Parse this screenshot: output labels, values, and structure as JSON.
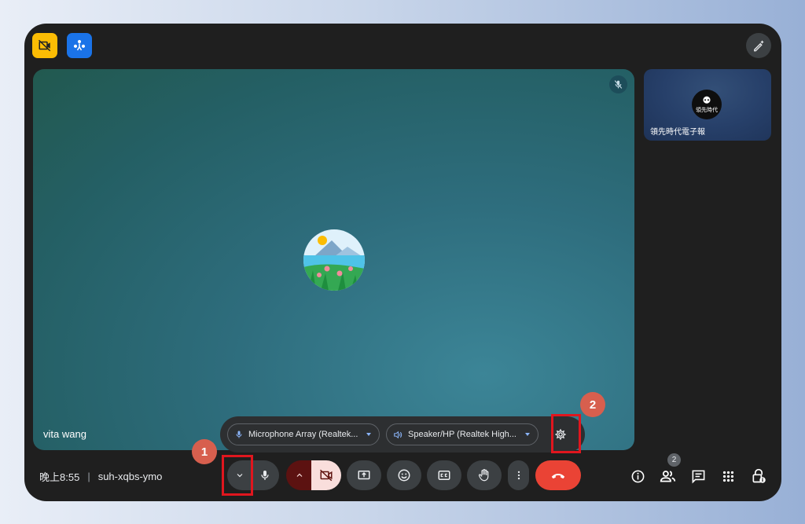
{
  "main_participant": {
    "name": "vita wang"
  },
  "side_participant": {
    "name": "領先時代電子報",
    "avatar_text": "領先時代"
  },
  "device_bar": {
    "microphone": "Microphone Array (Realtek...",
    "speaker": "Speaker/HP (Realtek High..."
  },
  "meeting": {
    "time": "晚上8:55",
    "code": "suh-xqbs-ymo",
    "separator": "|"
  },
  "participants_count": "2",
  "annotations": {
    "badge1": "1",
    "badge2": "2"
  },
  "colors": {
    "accent": "#1a73e8",
    "end_call": "#ea4335",
    "highlight": "#e0161e",
    "badge": "#d75f4e"
  },
  "icons": [
    "no-video-icon",
    "activity-icon",
    "magic-edit-icon",
    "mic-off-icon",
    "mic-icon",
    "speaker-icon",
    "dropdown-arrow-icon",
    "gear-icon",
    "chevron-down-icon",
    "chevron-up-icon",
    "camera-off-icon",
    "present-icon",
    "emoji-icon",
    "captions-icon",
    "raise-hand-icon",
    "more-vert-icon",
    "end-call-icon",
    "info-icon",
    "people-icon",
    "chat-icon",
    "apps-icon",
    "host-controls-icon"
  ]
}
